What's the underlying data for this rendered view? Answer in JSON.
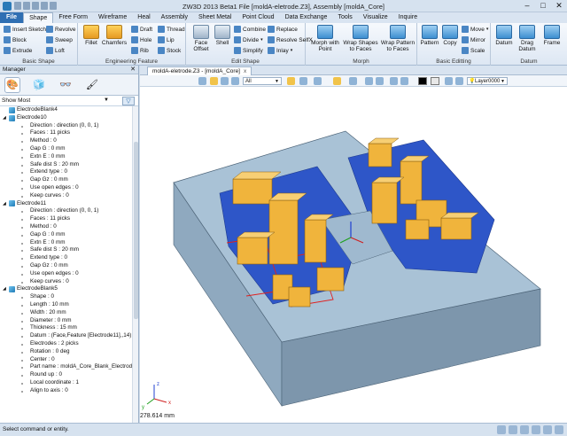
{
  "window": {
    "title": "ZW3D 2013 Beta1    File [moldA-eletrode.Z3], Assembly [moldA_Core]",
    "controls": [
      "–",
      "□",
      "✕"
    ]
  },
  "menubar": {
    "tabs": [
      "File",
      "Shape",
      "Free Form",
      "Wireframe",
      "Heal",
      "Assembly",
      "Sheet Metal",
      "Point Cloud",
      "Data Exchange",
      "Tools",
      "Visualize",
      "Inquire"
    ],
    "active": "Shape"
  },
  "ribbon": {
    "basic_shape": {
      "label": "Basic Shape",
      "buttons": [
        "Insert Sketch",
        "Revolve",
        "Block",
        "Sweep",
        "Extrude",
        "Loft"
      ]
    },
    "engineering": {
      "label": "Engineering Feature",
      "large": [
        "Fillet",
        "Chamfers"
      ],
      "buttons": [
        "Draft",
        "Thread",
        "Hole",
        "Lip",
        "Rib",
        "Stock"
      ]
    },
    "edit_shape": {
      "label": "Edit Shape",
      "large": [
        "Face Offset",
        "Shell"
      ],
      "buttons": [
        "Combine",
        "Replace",
        "Divide",
        "Resolve SelfX",
        "Simplify",
        "Inlay"
      ]
    },
    "morph": {
      "label": "Morph",
      "large": [
        "Morph with Point",
        "Wrap Shapes to Faces",
        "Wrap Pattern to Faces"
      ]
    },
    "basic_editing": {
      "label": "Basic Editting",
      "large": [
        "Pattern",
        "Copy"
      ],
      "buttons": [
        "Move",
        "Mirror",
        "Scale"
      ]
    },
    "datum": {
      "label": "Datum",
      "large": [
        "Datum",
        "Drag Datum",
        "Frame"
      ]
    }
  },
  "manager": {
    "title": "Manager",
    "close": "✕",
    "filter_value": "Show Most",
    "tree": [
      {
        "type": "node",
        "text": "ElectrodeBlank4",
        "twisty": ""
      },
      {
        "type": "node",
        "text": "Electrode10",
        "twisty": "◢"
      },
      {
        "type": "prop",
        "text": "Direction : direction (0, 0, 1)"
      },
      {
        "type": "prop",
        "text": "Faces : 11 picks"
      },
      {
        "type": "prop",
        "text": "Method : 0"
      },
      {
        "type": "prop",
        "text": "Gap G : 0 mm"
      },
      {
        "type": "prop",
        "text": "Extn E : 0 mm"
      },
      {
        "type": "prop",
        "text": "Safe dist S : 20 mm"
      },
      {
        "type": "prop",
        "text": "Extend type : 0"
      },
      {
        "type": "prop",
        "text": "Gap Gz : 0 mm"
      },
      {
        "type": "prop",
        "text": "Use open edges : 0"
      },
      {
        "type": "prop",
        "text": "Keep curves : 0"
      },
      {
        "type": "node",
        "text": "Electrode11",
        "twisty": "◢"
      },
      {
        "type": "prop",
        "text": "Direction : direction (0, 0, 1)"
      },
      {
        "type": "prop",
        "text": "Faces : 11 picks"
      },
      {
        "type": "prop",
        "text": "Method : 0"
      },
      {
        "type": "prop",
        "text": "Gap G : 0 mm"
      },
      {
        "type": "prop",
        "text": "Extn E : 0 mm"
      },
      {
        "type": "prop",
        "text": "Safe dist S : 20 mm"
      },
      {
        "type": "prop",
        "text": "Extend type : 0"
      },
      {
        "type": "prop",
        "text": "Gap Gz : 0 mm"
      },
      {
        "type": "prop",
        "text": "Use open edges : 0"
      },
      {
        "type": "prop",
        "text": "Keep curves : 0"
      },
      {
        "type": "node",
        "text": "ElectrodeBlank5",
        "twisty": "◢"
      },
      {
        "type": "prop",
        "text": "Shape : 0"
      },
      {
        "type": "prop",
        "text": "Length : 10 mm"
      },
      {
        "type": "prop",
        "text": "Width : 20 mm"
      },
      {
        "type": "prop",
        "text": "Diameter : 0 mm"
      },
      {
        "type": "prop",
        "text": "Thickness : 15 mm"
      },
      {
        "type": "prop",
        "text": "Datum : (Face,Feature [Electrode11],,14)"
      },
      {
        "type": "prop",
        "text": "Electrodes : 2 picks"
      },
      {
        "type": "prop",
        "text": "Rotation : 0 deg"
      },
      {
        "type": "prop",
        "text": "Center : 0"
      },
      {
        "type": "prop",
        "text": "Part name : moldA_Core_Blank_Electrode"
      },
      {
        "type": "prop",
        "text": "Round up : 0"
      },
      {
        "type": "prop",
        "text": "Local coordinate : 1"
      },
      {
        "type": "prop",
        "text": "Align to axis : 0"
      }
    ]
  },
  "document": {
    "tab_label": "moldA-eletrode.Z3 - [moldA_Core]",
    "close": "x"
  },
  "view_toolbar": {
    "filter_value": "All",
    "layer_value": "Layer0000"
  },
  "viewport": {
    "length_readout": "278.614 mm",
    "axis_labels": [
      "x",
      "y",
      "z"
    ]
  },
  "status": {
    "prompt": "Select command or entity."
  },
  "colors": {
    "electrode": "#f0b43c",
    "mold_top": "#a9c2d6",
    "cavity": "#2e56c8",
    "ribbon_accent": "#2f6fb3"
  }
}
